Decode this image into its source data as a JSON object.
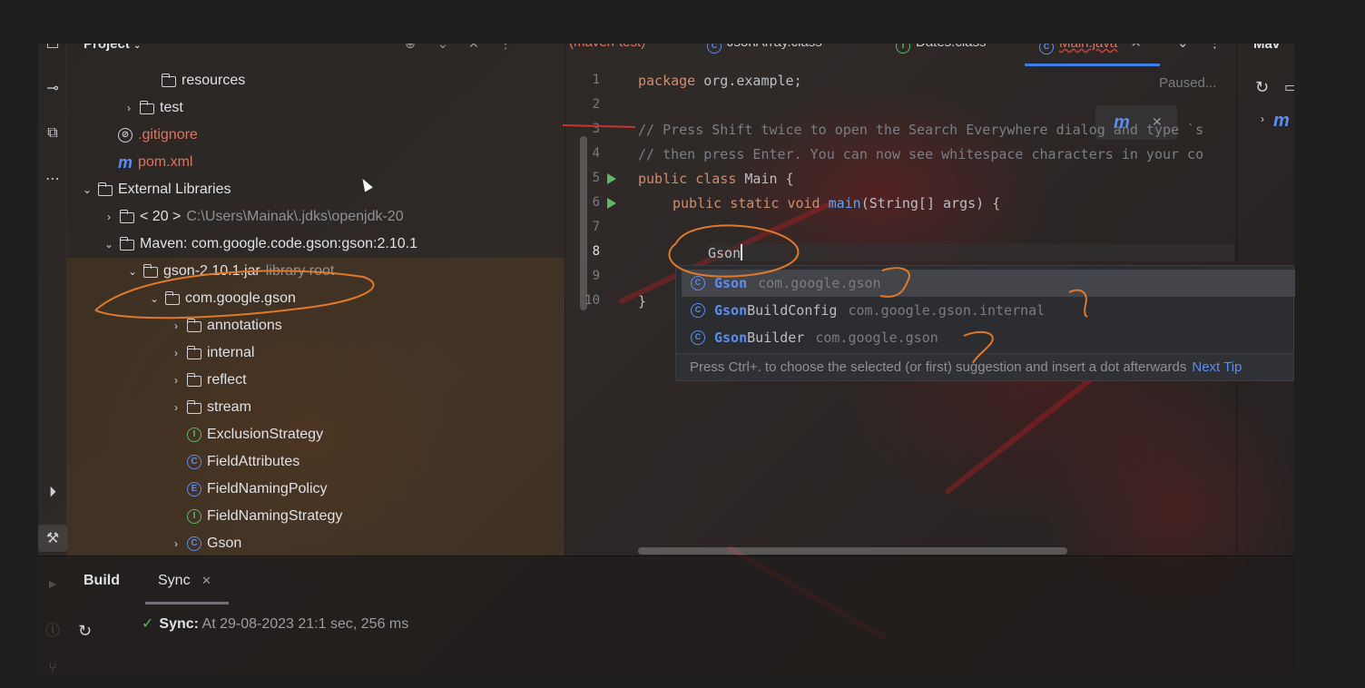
{
  "project": {
    "title": "Project",
    "tree": [
      {
        "label": "resources",
        "sub": "",
        "icon": "resources-folder-icon",
        "color": "#dfe1e5"
      },
      {
        "label": "test",
        "sub": "",
        "icon": "folder-icon",
        "color": "#dfe1e5"
      },
      {
        "label": ".gitignore",
        "sub": "",
        "icon": "ignore-file-icon",
        "color": "#e0735f"
      },
      {
        "label": "pom.xml",
        "sub": "",
        "icon": "maven-icon",
        "color": "#e0735f"
      },
      {
        "label": "External Libraries",
        "sub": "",
        "icon": "library-icon",
        "color": "#dfe1e5"
      },
      {
        "label": "< 20 >",
        "sub": "C:\\Users\\Mainak\\.jdks\\openjdk-20",
        "icon": "jdk-folder-icon",
        "color": "#dfe1e5"
      },
      {
        "label": "Maven: com.google.code.gson:gson:2.10.1",
        "sub": "",
        "icon": "maven-library-icon",
        "color": "#dfe1e5"
      },
      {
        "label": "gson-2.10.1.jar",
        "sub": "library root",
        "icon": "jar-icon",
        "color": "#dfe1e5"
      },
      {
        "label": "com.google.gson",
        "sub": "",
        "icon": "package-icon",
        "color": "#dfe1e5"
      },
      {
        "label": "annotations",
        "sub": "",
        "icon": "package-icon",
        "color": "#dfe1e5"
      },
      {
        "label": "internal",
        "sub": "",
        "icon": "package-icon",
        "color": "#dfe1e5"
      },
      {
        "label": "reflect",
        "sub": "",
        "icon": "package-icon",
        "color": "#dfe1e5"
      },
      {
        "label": "stream",
        "sub": "",
        "icon": "package-icon",
        "color": "#dfe1e5"
      },
      {
        "label": "ExclusionStrategy",
        "sub": "",
        "icon": "interface-icon",
        "color": "#dfe1e5"
      },
      {
        "label": "FieldAttributes",
        "sub": "",
        "icon": "class-icon",
        "color": "#dfe1e5"
      },
      {
        "label": "FieldNamingPolicy",
        "sub": "",
        "icon": "enum-icon",
        "color": "#dfe1e5"
      },
      {
        "label": "FieldNamingStrategy",
        "sub": "",
        "icon": "interface-icon",
        "color": "#dfe1e5"
      },
      {
        "label": "Gson",
        "sub": "",
        "icon": "class-icon",
        "color": "#dfe1e5"
      }
    ]
  },
  "editor": {
    "tabs": [
      {
        "label": "(maven-test)",
        "icon": "",
        "color": "#e0735f"
      },
      {
        "label": "JsonArray.class",
        "icon": "C",
        "color": "#c9cbcf"
      },
      {
        "label": "Dates.class",
        "icon": "I",
        "color": "#c9cbcf"
      },
      {
        "label": "Main.java",
        "icon": "C",
        "color": "#e0735f"
      }
    ],
    "status": "Paused...",
    "lines": [
      {
        "n": "1",
        "text": ""
      },
      {
        "n": "2",
        "text": ""
      },
      {
        "n": "3",
        "text": "// Press Shift twice to open the Search Everywhere dialog and type `s"
      },
      {
        "n": "4",
        "text": "// then press Enter. You can now see whitespace characters in your co"
      },
      {
        "n": "5",
        "text": ""
      },
      {
        "n": "6",
        "text": ""
      },
      {
        "n": "7",
        "text": ""
      },
      {
        "n": "8",
        "text": "Gson"
      },
      {
        "n": "9",
        "text": ""
      },
      {
        "n": "10",
        "text": "}"
      }
    ],
    "line1": {
      "kw": "package",
      "rest": " org.example;"
    },
    "line5": {
      "kw": "public class",
      "rest": " Main {"
    },
    "line6": {
      "kw": "public static void",
      "fn": "main",
      "rest": "(String[] args) {"
    }
  },
  "completion": {
    "items": [
      {
        "match": "Gson",
        "rest": "",
        "pkg": "com.google.gson"
      },
      {
        "match": "Gson",
        "rest": "BuildConfig",
        "pkg": "com.google.gson.internal"
      },
      {
        "match": "Gson",
        "rest": "Builder",
        "pkg": "com.google.gson"
      }
    ],
    "hint": "Press Ctrl+. to choose the selected (or first) suggestion and insert a dot afterwards",
    "next_tip": "Next Tip"
  },
  "right_panel": {
    "title": "Mav"
  },
  "build": {
    "tabs": [
      "Build",
      "Sync"
    ],
    "sync_label": "Sync:",
    "sync_detail": "At 29-08-2023 21:",
    "sync_duration": "1 sec, 256 ms"
  }
}
